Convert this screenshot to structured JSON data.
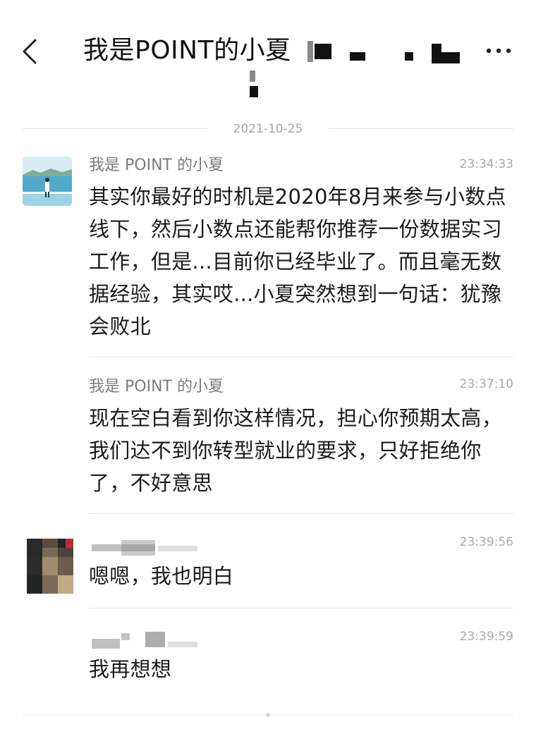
{
  "header": {
    "title": "我是POINT的小夏",
    "back_icon": "chevron-left-icon",
    "more_icon": "more-dots-icon"
  },
  "date_divider": "2021-10-25",
  "messages": [
    {
      "sender": "我是 POINT 的小夏",
      "time": "23:34:33",
      "text": "其实你最好的时机是2020年8月来参与小数点线下，然后小数点还能帮你推荐一份数据实习工作，但是...目前你已经毕业了。而且毫无数据经验，其实哎...小夏突然想到一句话：犹豫会败北"
    },
    {
      "sender": "我是 POINT 的小夏",
      "time": "23:37:10",
      "text": "现在空白看到你这样情况，担心你预期太高，我们达不到你转型就业的要求，只好拒绝你了，不好意思"
    },
    {
      "sender": "",
      "time": "23:39:56",
      "text": "嗯嗯，我也明白"
    },
    {
      "sender": "",
      "time": "23:39:59",
      "text": "我再想想"
    }
  ]
}
